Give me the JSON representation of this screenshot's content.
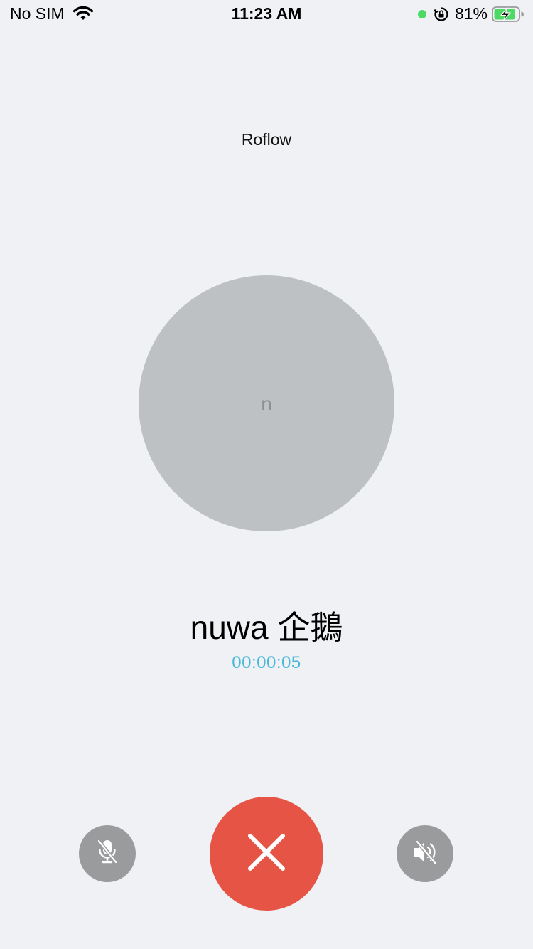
{
  "status_bar": {
    "carrier": "No SIM",
    "time": "11:23 AM",
    "battery_percent": "81%",
    "dot_color": "#4cd964"
  },
  "call": {
    "app_name": "Roflow",
    "avatar_letter": "n",
    "caller_name": "nuwa 企鵝",
    "duration": "00:00:05"
  },
  "controls": {
    "mute_icon": "microphone-muted-icon",
    "hangup_icon": "close-icon",
    "speaker_icon": "speaker-muted-icon"
  },
  "colors": {
    "background": "#eff1f4",
    "avatar": "#bec1c4",
    "timer": "#4ab8d8",
    "hangup": "#e55444",
    "control": "#9a9b9d"
  }
}
